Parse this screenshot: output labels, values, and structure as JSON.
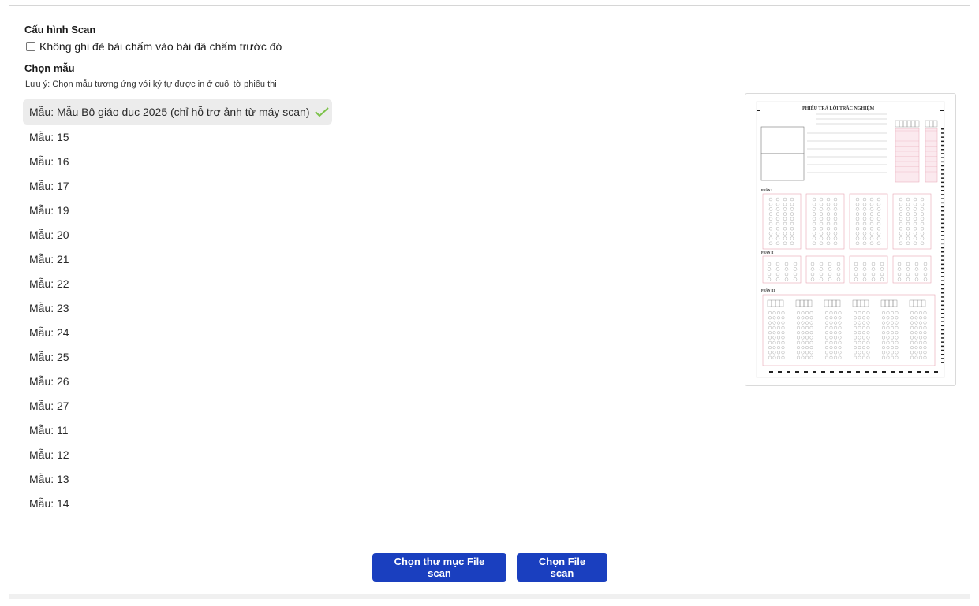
{
  "config": {
    "title": "Cấu hình Scan",
    "overwrite_label": "Không ghi đè bài chấm vào bài đã chấm trước đó",
    "overwrite_checked": false
  },
  "template": {
    "title": "Chọn mẫu",
    "note": "Lưu ý: Chọn mẫu tương ứng với ký tự được in ở cuối tờ phiếu thi",
    "items": [
      "Mẫu: Mẫu Bộ giáo dục 2025 (chỉ hỗ trợ ảnh từ máy scan)",
      "Mẫu: 15",
      "Mẫu: 16",
      "Mẫu: 17",
      "Mẫu: 19",
      "Mẫu: 20",
      "Mẫu: 21",
      "Mẫu: 22",
      "Mẫu: 23",
      "Mẫu: 24",
      "Mẫu: 25",
      "Mẫu: 26",
      "Mẫu: 27",
      "Mẫu: 11",
      "Mẫu: 12",
      "Mẫu: 13",
      "Mẫu: 14"
    ],
    "selected_index": 0
  },
  "preview": {
    "heading": "PHIẾU TRẢ LỜI TRẮC NGHIỆM",
    "part1": "PHẦN I",
    "part2": "PHẦN II",
    "part3": "PHẦN III"
  },
  "actions": {
    "choose_folder": "Chọn thư mục File scan",
    "choose_file": "Chọn File scan"
  },
  "colors": {
    "primary": "#1a3fbf",
    "check": "#7cc24a",
    "sheet_pink": "#e7a6b4"
  }
}
